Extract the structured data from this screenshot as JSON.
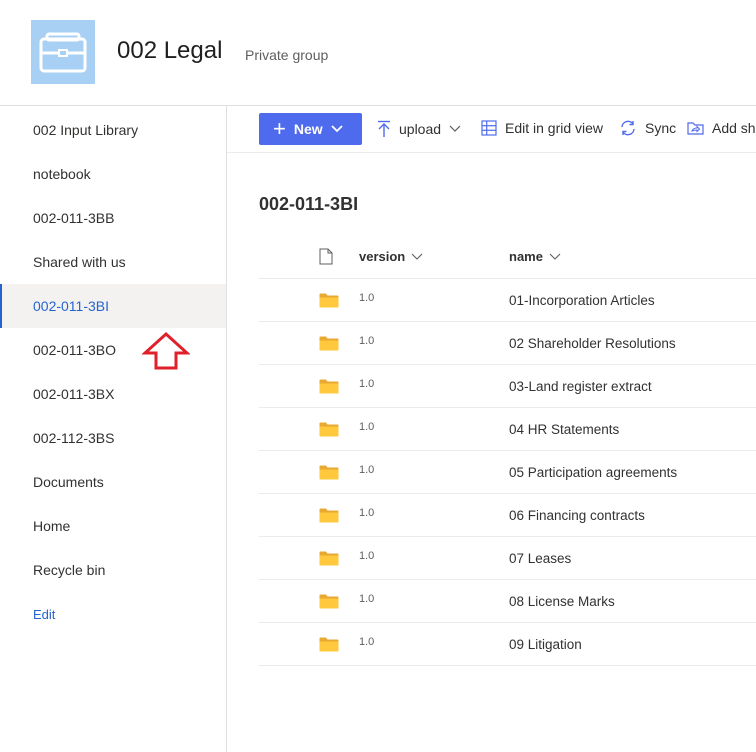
{
  "header": {
    "title": "002 Legal",
    "subtitle": "Private group",
    "logo_icon": "briefcase-icon"
  },
  "sidebar": {
    "items": [
      {
        "label": "002 Input Library"
      },
      {
        "label": "notebook"
      },
      {
        "label": "002-011-3BB"
      },
      {
        "label": "Shared with us"
      },
      {
        "label": "002-011-3BI",
        "selected": true
      },
      {
        "label": "002-011-3BO"
      },
      {
        "label": "002-011-3BX"
      },
      {
        "label": "002-112-3BS"
      },
      {
        "label": "Documents"
      },
      {
        "label": "Home"
      },
      {
        "label": "Recycle bin"
      }
    ],
    "edit_label": "Edit"
  },
  "toolbar": {
    "new_label": "New",
    "upload_label": "upload",
    "grid_label": "Edit in grid view",
    "sync_label": "Sync",
    "add_shortcut_label": "Add sh"
  },
  "library": {
    "title": "002-011-3BI",
    "columns": {
      "version": "version",
      "name": "name"
    },
    "rows": [
      {
        "version": "1.0",
        "name": "01-Incorporation Articles"
      },
      {
        "version": "1.0",
        "name": "02 Shareholder Resolutions"
      },
      {
        "version": "1.0",
        "name": "03-Land register extract"
      },
      {
        "version": "1.0",
        "name": "04 HR Statements"
      },
      {
        "version": "1.0",
        "name": "05 Participation agreements"
      },
      {
        "version": "1.0",
        "name": "06 Financing contracts"
      },
      {
        "version": "1.0",
        "name": "07 Leases"
      },
      {
        "version": "1.0",
        "name": "08 License Marks"
      },
      {
        "version": "1.0",
        "name": "09 Litigation"
      }
    ]
  },
  "colors": {
    "accent": "#4f6bed",
    "link": "#2564cf",
    "folder": "#ffc83d",
    "arrow": "#e0212b",
    "logo_bg": "#a8d0f5"
  }
}
